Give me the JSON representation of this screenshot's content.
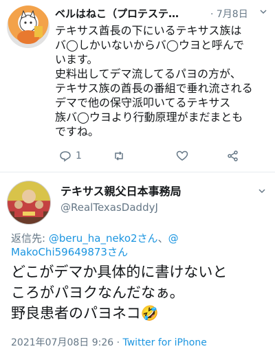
{
  "tweet1": {
    "author_name": "ベルはねこ（プロテステ…",
    "date": "· 7月8日",
    "body_lines": [
      "テキサス酋長の下にいるテキサス族は",
      "バ◯しかいないからバ◯ウヨと呼んで",
      "います。",
      "史料出してデマ流してるパヨの方が、",
      "テキサス族の酋長の番組で垂れ流される",
      "デマで他の保守派叩いてるテキサス",
      "族バ◯ウヨより行動原理がまだまとも",
      "ですね。"
    ],
    "reply_count": "1",
    "icons": [
      "reply-icon",
      "retweet-icon",
      "like-icon",
      "share-icon"
    ]
  },
  "tweet2": {
    "author_name": "テキサス親父日本事務局",
    "handle": "@RealTexasDaddyJ",
    "reply_prefix": "返信先: ",
    "reply_to_1": "@beru_ha_neko2さん",
    "reply_sep": "、",
    "reply_to_2_line1": "@",
    "reply_to_2_line2": "MakoChi59649873さん",
    "body_lines": [
      "どこがデマか具体的に書けないと",
      "ころがパヨクなんだなぁ。",
      "野良患者のパヨネコ"
    ],
    "emoji": "🤣",
    "timestamp": "2021年07月08日 9:26 · ",
    "source": "Twitter for iPhone"
  },
  "colors": {
    "link": "#1b95e0",
    "muted": "#657786",
    "text": "#14171a"
  }
}
